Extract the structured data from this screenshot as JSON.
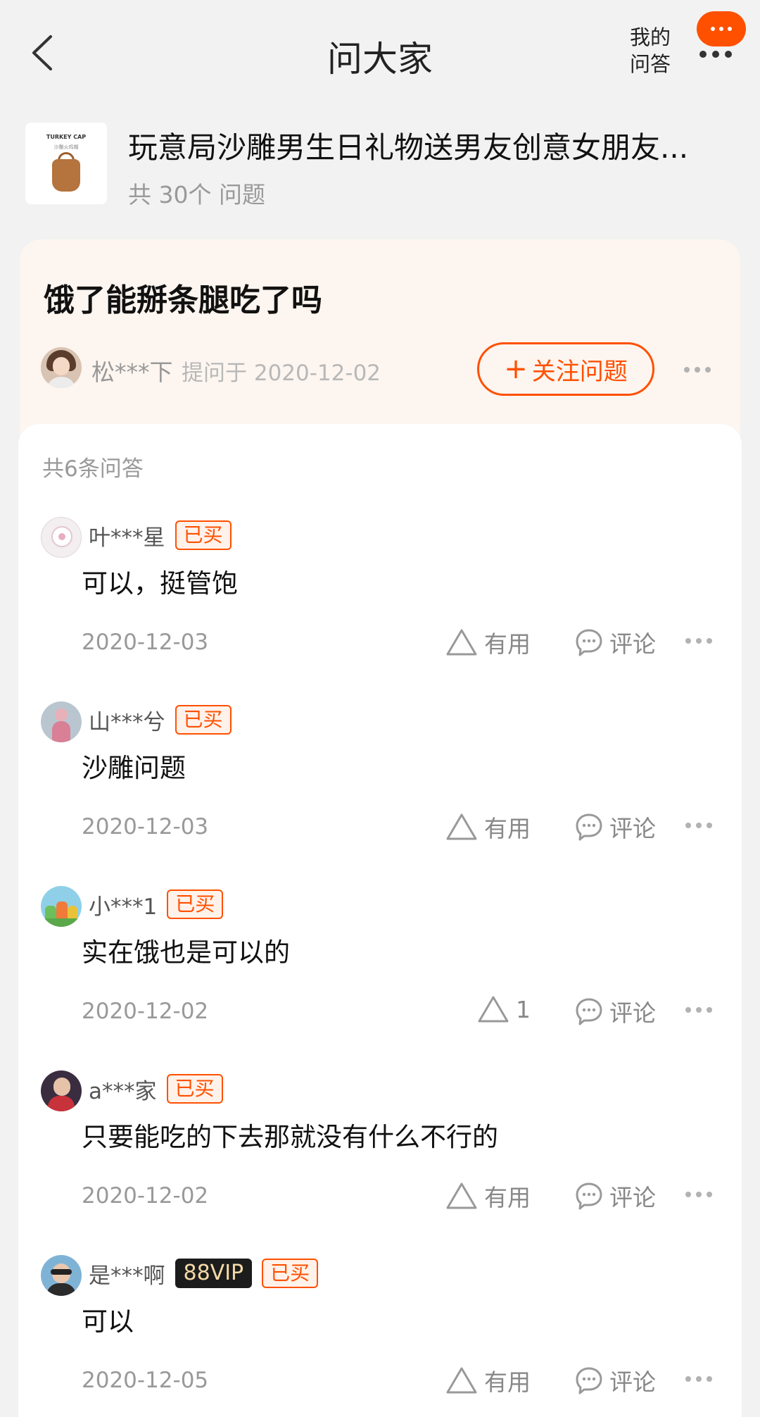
{
  "header": {
    "title": "问大家",
    "my_answers_line1": "我的",
    "my_answers_line2": "问答",
    "accent_color": "#ff5000"
  },
  "product": {
    "thumb_line1": "TURKEY CAP",
    "thumb_line2": "沙雕火鸡帽",
    "name": "玩意局沙雕男生日礼物送男友创意女朋友...",
    "question_count": "共 30个 问题"
  },
  "question": {
    "title": "饿了能掰条腿吃了吗",
    "asker": "松***下",
    "asked_at": "提问于 2020-12-02",
    "follow_label": "关注问题",
    "follow_plus": "+"
  },
  "answers_section": {
    "count_label": "共6条问答"
  },
  "answers": [
    {
      "user": "叶***星",
      "badge": "已买",
      "vip": "",
      "text": "可以，挺管饱",
      "date": "2020-12-03",
      "useful": "有用",
      "comment": "评论"
    },
    {
      "user": "山***兮",
      "badge": "已买",
      "vip": "",
      "text": "沙雕问题",
      "date": "2020-12-03",
      "useful": "有用",
      "comment": "评论"
    },
    {
      "user": "小***1",
      "badge": "已买",
      "vip": "",
      "text": "实在饿也是可以的",
      "date": "2020-12-02",
      "useful": "1",
      "comment": "评论"
    },
    {
      "user": "a***家",
      "badge": "已买",
      "vip": "",
      "text": "只要能吃的下去那就没有什么不行的",
      "date": "2020-12-02",
      "useful": "有用",
      "comment": "评论"
    },
    {
      "user": "是***啊",
      "badge": "已买",
      "vip": "88VIP",
      "text": "可以",
      "date": "2020-12-05",
      "useful": "有用",
      "comment": "评论"
    }
  ]
}
